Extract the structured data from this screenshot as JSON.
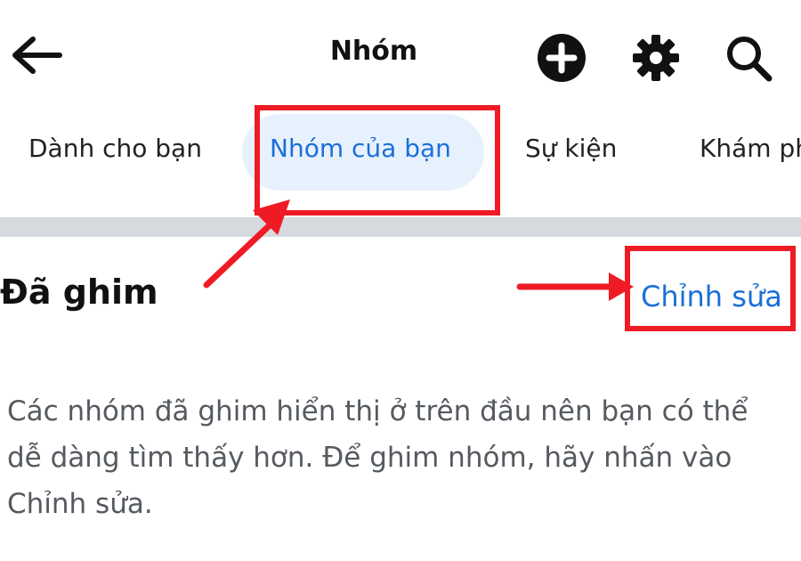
{
  "header": {
    "title": "Nhóm",
    "back_icon": "arrow-left-icon",
    "add_icon": "plus-circle-icon",
    "settings_icon": "gear-icon",
    "search_icon": "search-icon"
  },
  "tabs": [
    {
      "label": "Dành cho bạn",
      "active": false
    },
    {
      "label": "Nhóm của bạn",
      "active": true
    },
    {
      "label": "Sự kiện",
      "active": false
    },
    {
      "label": "Khám phá",
      "active": false
    }
  ],
  "pinned": {
    "title": "Đã ghim",
    "edit_label": "Chỉnh sửa",
    "description": "Các nhóm đã ghim hiển thị ở trên đầu nên bạn có thể dễ dàng tìm thấy hơn. Để ghim nhóm, hãy nhấn vào Chỉnh sửa."
  },
  "colors": {
    "accent": "#1b6fd8",
    "annotation": "#ef1b24",
    "active_tab_bg": "#e7f1fd",
    "divider": "#d6d9de"
  }
}
